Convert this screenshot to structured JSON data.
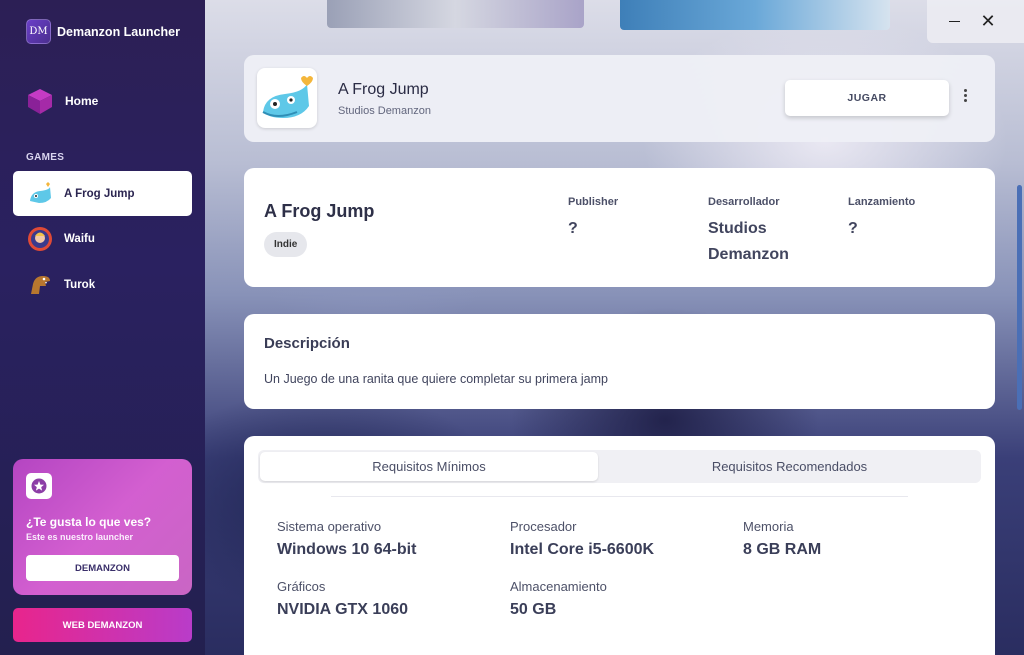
{
  "app": {
    "logo_text": "DM",
    "name": "Demanzon Launcher"
  },
  "nav": {
    "home_label": "Home",
    "section_label": "GAMES"
  },
  "games": [
    {
      "label": "A Frog Jump",
      "icon": "frog-icon",
      "active": true
    },
    {
      "label": "Waifu",
      "icon": "waifu-icon",
      "active": false
    },
    {
      "label": "Turok",
      "icon": "dinosaur-icon",
      "active": false
    }
  ],
  "promo": {
    "title": "¿Te gusta lo que ves?",
    "subtitle": "Este es nuestro launcher",
    "button": "DEMANZON",
    "icon": "star-icon"
  },
  "web_button": "WEB DEMANZON",
  "window": {
    "minimize_icon": "minimize-icon",
    "close_icon": "close-icon",
    "close_glyph": "✕"
  },
  "game_header": {
    "title": "A Frog Jump",
    "studio": "Studios Demanzon",
    "play_label": "JUGAR"
  },
  "info": {
    "title": "A Frog Jump",
    "tag": "Indie",
    "publisher_label": "Publisher",
    "publisher_value": "?",
    "developer_label": "Desarrollador",
    "developer_value_1": "Studios",
    "developer_value_2": "Demanzon",
    "release_label": "Lanzamiento",
    "release_value": "?"
  },
  "description": {
    "title": "Descripción",
    "text": "Un Juego de una ranita que quiere completar su primera jamp"
  },
  "requirements": {
    "tabs": [
      "Requisitos Mínimos",
      "Requisitos Recomendados"
    ],
    "active_tab": 0,
    "items": [
      {
        "label": "Sistema operativo",
        "value": "Windows 10 64-bit"
      },
      {
        "label": "Procesador",
        "value": "Intel Core i5-6600K"
      },
      {
        "label": "Memoria",
        "value": "8 GB RAM"
      },
      {
        "label": "Gráficos",
        "value": "NVIDIA GTX 1060"
      },
      {
        "label": "Almacenamiento",
        "value": "50 GB"
      }
    ]
  },
  "colors": {
    "accent_pink": "#e8258c",
    "sidebar": "#2a2160",
    "scrollbar": "#4a6fb6"
  }
}
